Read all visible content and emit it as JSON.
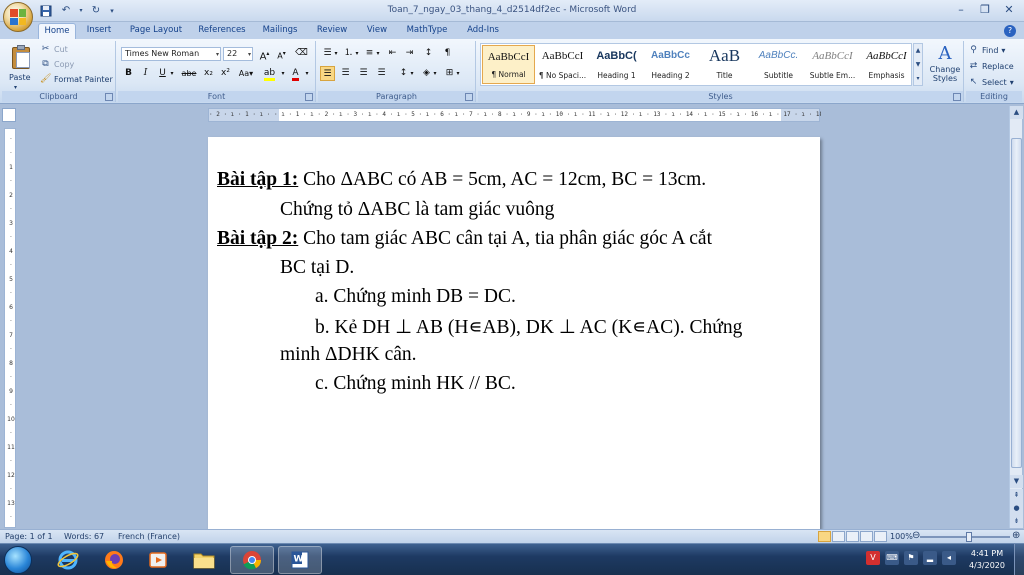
{
  "window": {
    "title": "Toan_7_ngay_03_thang_4_d2514df2ec - Microsoft Word"
  },
  "tabs": [
    "Home",
    "Insert",
    "Page Layout",
    "References",
    "Mailings",
    "Review",
    "View",
    "MathType",
    "Add-Ins"
  ],
  "clipboard": {
    "paste": "Paste",
    "cut": "Cut",
    "copy": "Copy",
    "format_painter": "Format Painter",
    "label": "Clipboard"
  },
  "font": {
    "name": "Times New Roman",
    "size": "22",
    "label": "Font",
    "bold": "B",
    "italic": "I",
    "underline": "U",
    "strike": "abe",
    "subscript": "x₂",
    "superscript": "x²",
    "change_case": "Aa",
    "grow": "A",
    "shrink": "A"
  },
  "paragraph": {
    "label": "Paragraph"
  },
  "styles": {
    "label": "Styles",
    "items": [
      {
        "sample": "AaBbCcI",
        "name": "¶ Normal"
      },
      {
        "sample": "AaBbCcI",
        "name": "¶ No Spaci..."
      },
      {
        "sample": "AaBbC(",
        "name": "Heading 1"
      },
      {
        "sample": "AaBbCc",
        "name": "Heading 2"
      },
      {
        "sample": "AaB",
        "name": "Title"
      },
      {
        "sample": "AaBbCc.",
        "name": "Subtitle"
      },
      {
        "sample": "AaBbCcI",
        "name": "Subtle Em..."
      },
      {
        "sample": "AaBbCcI",
        "name": "Emphasis"
      }
    ],
    "change_styles": "Change Styles"
  },
  "editing": {
    "label": "Editing",
    "find": "Find",
    "replace": "Replace",
    "select": "Select"
  },
  "ruler": {
    "text": "· 2 · ı · 1 · ı ·   · ı · 1 · ı · 2 · ı · 3 · ı · 4 · ı · 5 · ı · 6 · ı · 7 · ı · 8 · ı · 9 · ı · 10 · ı · 11 · ı · 12 · ı · 13 · ı · 14 · ı · 15 · ı · 16 · ı · 17 · ı · 18 · ı 19"
  },
  "document": {
    "line1_label": "Bài tập 1:",
    "line1_text": " Cho ΔABC có AB = 5cm, AC = 12cm, BC = 13cm.",
    "line2": "Chứng tỏ ΔABC là tam giác vuông",
    "line3_label": "Bài tập 2:",
    "line3_text": " Cho tam giác ABC cân tại A, tia phân giác góc A cắt",
    "line4": "BC tại D.",
    "line5": "a. Chứng minh DB = DC.",
    "line6": "b. Kẻ DH ⊥ AB (H∊AB), DK ⊥ AC (K∊AC). Chứng",
    "line7": "minh ΔDHK cân.",
    "line8": "c. Chứng minh HK // BC."
  },
  "status": {
    "page": "Page: 1 of 1",
    "words": "Words: 67",
    "language": "French (France)",
    "zoom": "100%"
  },
  "clock": {
    "time": "4:41 PM",
    "date": "4/3/2020"
  }
}
